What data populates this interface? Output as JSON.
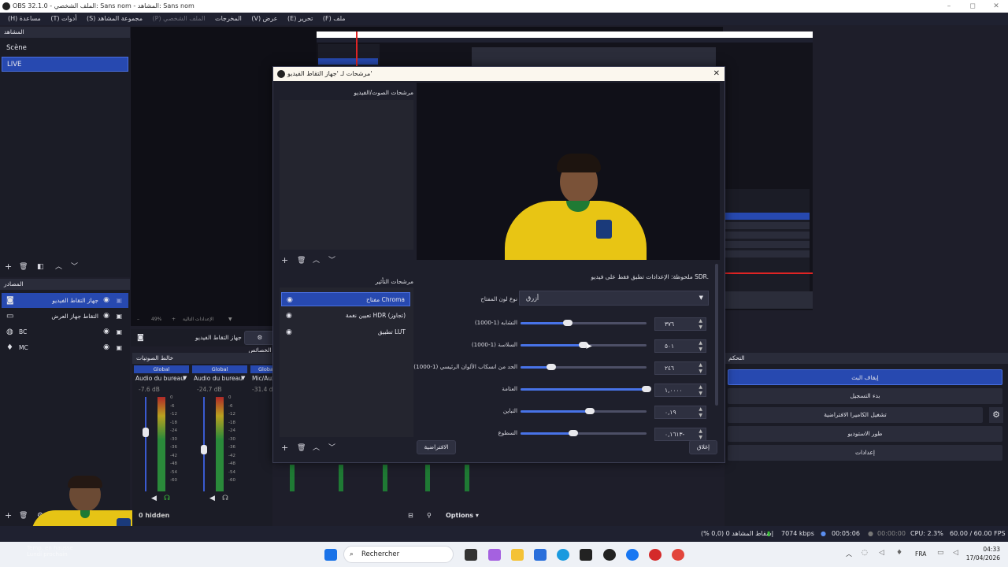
{
  "window": {
    "title": "OBS 32.1.0 - الملف الشخصي: Sans nom - المشاهد: Sans nom",
    "minimize": "–",
    "maximize": "◻",
    "close": "✕"
  },
  "menu": [
    "ملف (F)",
    "تحرير (E)",
    "عرض (V)",
    "المخرجات",
    "الملف الشخصي (P)",
    "مجموعة المشاهد (S)",
    "أدوات (T)",
    "مساعدة (H)"
  ],
  "scenes": {
    "header": "المشاهد",
    "items": [
      "Scène",
      "LIVE"
    ],
    "selected": 1
  },
  "sources": {
    "header": "المصادر",
    "items": [
      {
        "name": "جهاز التقاط الفيديو",
        "icon": "camera-icon"
      },
      {
        "name": "التقاط جهاز العرض",
        "icon": "monitor-icon"
      },
      {
        "name": "BC",
        "icon": "globe-icon"
      },
      {
        "name": "MC",
        "icon": "mic-icon"
      }
    ]
  },
  "preview_toolbar": {
    "zoom": "49%",
    "scale_label": "الإعدادات التالية",
    "source_label": "جهاز التقاط الفيديو",
    "props_button": "الخصائص"
  },
  "mixer": {
    "header": "خالط الصوتيات",
    "global": "Global",
    "channels": [
      {
        "name": "Audio du bureau",
        "db": "-7.6 dB",
        "level": 0.35
      },
      {
        "name": "Audio du bureau",
        "db": "-24.7 dB",
        "level": 0.55
      },
      {
        "name": "Mic/Aux",
        "db": "-31.4 dB",
        "level": 0.7
      }
    ],
    "ticks": [
      "0",
      "-6",
      "-12",
      "-18",
      "-24",
      "-30",
      "-36",
      "-42",
      "-48",
      "-54",
      "-60"
    ],
    "hidden": "0 hidden",
    "options": "Options"
  },
  "controls": {
    "header": "التحكم",
    "buttons": [
      "إيقاف البث",
      "بدء التسجيل",
      "تشغيل الكاميرا الافتراضية",
      "طور الاستوديو",
      "إعدادات"
    ]
  },
  "dialog": {
    "title": "مرشحات لـ 'جهاز التقاط الفيديو'",
    "audio_video_filters": "مرشحات الصوت/الفيديو",
    "effect_filters": "مرشحات التأثير",
    "filters": [
      "مفتاح Chroma",
      "تعيين نغمة HDR (تجاوز)",
      "تطبيق LUT"
    ],
    "info": "ملحوظة: الإعدادات تطبق فقط على فيديو SDR.",
    "key_color_label": "نوع لون المفتاح",
    "key_color_value": "أزرق",
    "params": [
      {
        "label": "التشابه (1-1000)",
        "value": "٣٧٦",
        "frac": 0.376
      },
      {
        "label": "السلاسة (1-1000)",
        "value": "٥٠١",
        "frac": 0.501
      },
      {
        "label": "الحد من انسكاب الألوان الرئيسي (1-1000)",
        "value": "٢٤٦",
        "frac": 0.246
      },
      {
        "label": "العتامة",
        "value": "١,٠٠٠٠",
        "frac": 1.0
      },
      {
        "label": "التباين",
        "value": "٠,١٩",
        "frac": 0.55
      },
      {
        "label": "السطوع",
        "value": "٠,١٦١٣-",
        "frac": 0.42
      }
    ],
    "defaults_button": "الافتراضية",
    "close_button": "إغلاق"
  },
  "status": {
    "dropped": "إسقاط المشاهد 0 (0,0 %)",
    "kbps": "7074 kbps",
    "stream_time": "00:05:06",
    "rec_time": "00:00:00",
    "cpu": "CPU: 2.3%",
    "fps": "60.00 / 60.00 FPS"
  },
  "taskbar": {
    "search": "Rechercher",
    "lang": "FRA",
    "time": "04:33",
    "date": "17/04/2026",
    "weather_line1": "Temp. en hausse",
    "weather_line2": "Lundi prochain"
  },
  "colors": {
    "accent": "#2749b0",
    "background": "#1e1f2b",
    "dialog_title": "#fbf7ee"
  }
}
